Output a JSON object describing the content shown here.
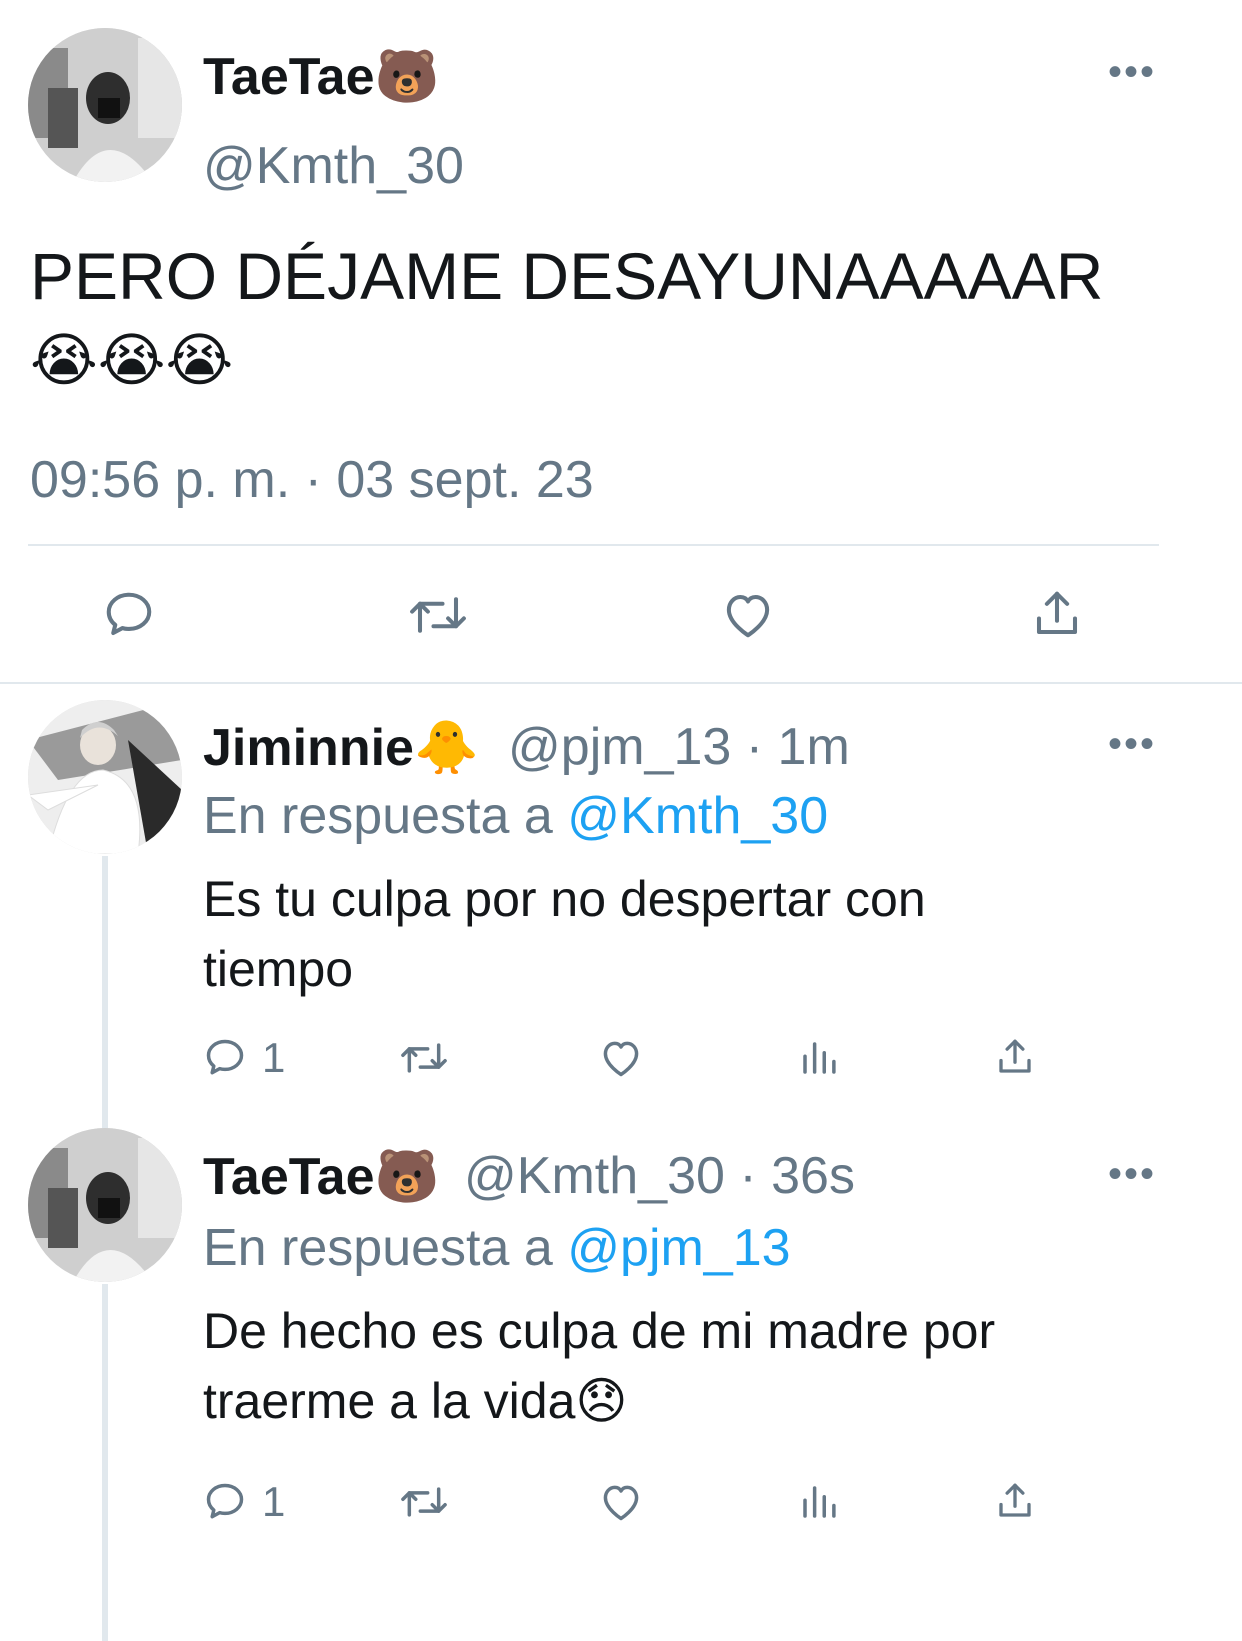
{
  "main_tweet": {
    "display_name": "TaeTae",
    "name_emoji": "🐻",
    "handle": "@Kmth_30",
    "more_label": "•••",
    "text": "PERO DÉJAME DESAYUNAAAAAR",
    "text_emojis": "😭😭😭",
    "timestamp": "09:56 p. m. · 03 sept. 23"
  },
  "replies": [
    {
      "display_name": "Jiminnie",
      "name_emoji": "🐥",
      "handle_time": "@pjm_13 · 1m",
      "more_label": "•••",
      "reply_prefix": "En respuesta a",
      "reply_to": "@Kmth_30",
      "text_line1": "Es tu culpa por no despertar con",
      "text_line2": "tiempo",
      "reply_count": "1"
    },
    {
      "display_name": "TaeTae",
      "name_emoji": "🐻",
      "handle_time": "@Kmth_30 · 36s",
      "more_label": "•••",
      "reply_prefix": "En respuesta a",
      "reply_to": "@pjm_13",
      "text_line1": "De hecho es culpa de mi madre por",
      "text_line2": "traerme a la vida",
      "text_emoji": "😞",
      "reply_count": "1"
    }
  ],
  "icons": [
    "reply-icon",
    "retweet-icon",
    "like-icon",
    "share-icon",
    "analytics-icon",
    "more-icon"
  ],
  "colors": {
    "text": "#14171a",
    "secondary": "#657786",
    "link": "#1da1f2",
    "divider": "#e1e8ed"
  }
}
